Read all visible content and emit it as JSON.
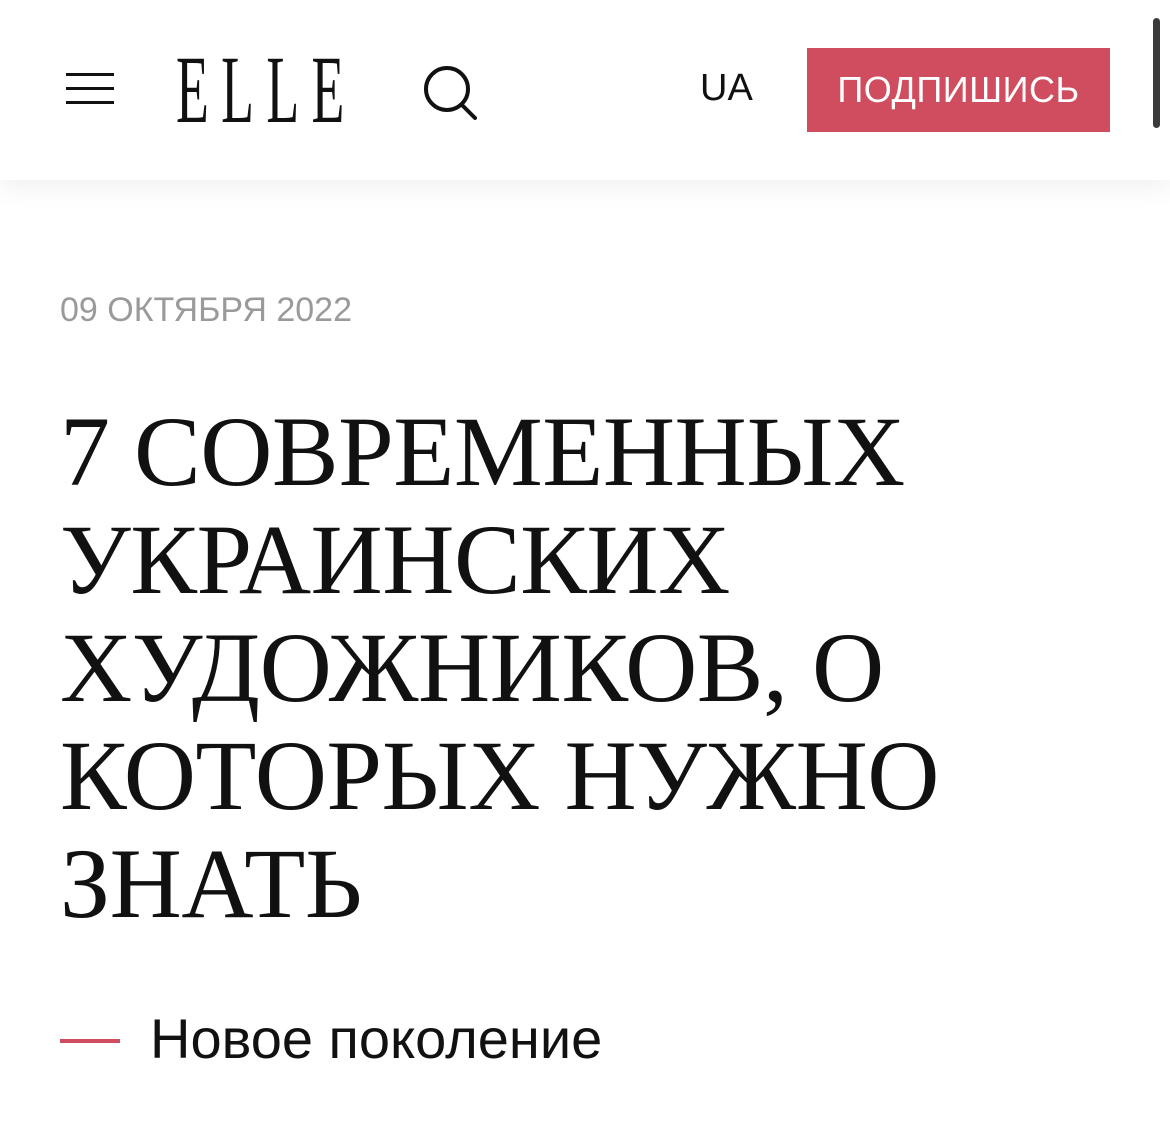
{
  "header": {
    "logo_text": "ELLE",
    "language_label": "UA",
    "subscribe_label": "ПОДПИШИСЬ",
    "menu_icon": "hamburger-menu-icon",
    "search_icon": "search-icon"
  },
  "article": {
    "date": "09 ОКТЯБРЯ 2022",
    "title_lines": [
      "7 СОВРЕМЕННЫХ",
      "УКРАИНСКИХ",
      "ХУДОЖНИКОВ, О",
      "КОТОРЫХ НУЖНО",
      "ЗНАТЬ"
    ],
    "category": "Новое поколение"
  },
  "colors": {
    "accent": "#cf4d5e",
    "text": "#111111",
    "muted": "#9a9a9a",
    "background": "#ffffff"
  }
}
